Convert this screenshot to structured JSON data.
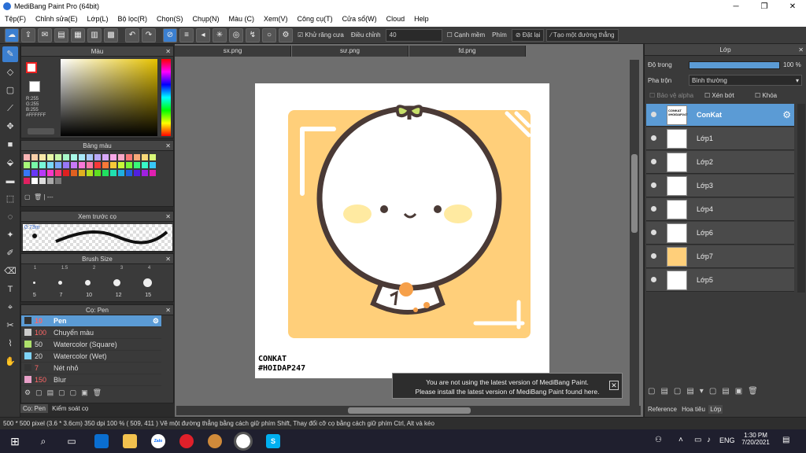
{
  "app": {
    "title": "MediBang Paint Pro (64bit)"
  },
  "menu": [
    "Tệp(F)",
    "Chỉnh sửa(E)",
    "Lớp(L)",
    "Bộ lọc(R)",
    "Chọn(S)",
    "Chụp(N)",
    "Màu (C)",
    "Xem(V)",
    "Công cụ(T)",
    "Cửa sổ(W)",
    "Cloud",
    "Help"
  ],
  "toolbar": {
    "antialias": "Khử răng cưa",
    "adjust": "Điều chỉnh",
    "adjust_value": "40",
    "edge": "Cạnh mềm",
    "key": "Phím",
    "reset": "Đặt lại",
    "straight": "Tạo một đường thẳng"
  },
  "color_panel": {
    "title": "Màu",
    "r": "R:255",
    "g": "G:255",
    "b": "B:255",
    "hex": "#FFFFFF"
  },
  "palette_panel": {
    "title": "Bảng màu",
    "name": "---"
  },
  "preview_panel": {
    "title": "Xem trước cọ",
    "size": "0.73m"
  },
  "brushsize_panel": {
    "title": "Brush Size",
    "sizes": [
      "5",
      "7",
      "10",
      "12",
      "15"
    ],
    "top_sizes": [
      "1",
      "1.5",
      "2",
      "3",
      "4"
    ]
  },
  "brush_panel": {
    "title": "Cọ: Pen",
    "items": [
      {
        "num": "10",
        "name": "Pen",
        "color": "#333333"
      },
      {
        "num": "100",
        "name": "Chuyển màu",
        "color": "#cccccc"
      },
      {
        "num": "50",
        "name": "Watercolor (Square)",
        "color": "#aee06b"
      },
      {
        "num": "20",
        "name": "Watercolor (Wet)",
        "color": "#7fd3f7"
      },
      {
        "num": "7",
        "name": "Nét nhỏ",
        "color": "#333333"
      },
      {
        "num": "150",
        "name": "Blur",
        "color": "#e8a0c8"
      }
    ]
  },
  "bottom_tabs": {
    "left1": "Cọ: Pen",
    "left2": "Kiểm soát cọ",
    "right1": "Reference",
    "right2": "Hoa tiêu",
    "right3": "Lớp"
  },
  "tabs": [
    "sx.png",
    "sư.png",
    "fd.png"
  ],
  "layer_panel": {
    "title": "Lớp",
    "opacity_label": "Độ trong",
    "opacity_value": "100 %",
    "blend_label": "Pha trộn",
    "blend_value": "Bình thường",
    "protect_alpha": "Bảo vệ alpha",
    "clipping": "Xén bớt",
    "lock": "Khóa",
    "layers": [
      {
        "name": "ConKat",
        "selected": true
      },
      {
        "name": "Lớp1",
        "selected": false
      },
      {
        "name": "Lớp2",
        "selected": false
      },
      {
        "name": "Lớp3",
        "selected": false
      },
      {
        "name": "Lớp4",
        "selected": false
      },
      {
        "name": "Lớp6",
        "selected": false
      },
      {
        "name": "Lớp7",
        "selected": false
      },
      {
        "name": "Lớp5",
        "selected": false
      }
    ]
  },
  "artwork": {
    "line1": "CONKAT",
    "line2": "#HOIDAP247",
    "thumb_text": "CONKAT #HOIDAP247"
  },
  "toast": {
    "line1": "You are not using the latest version of MediBang Paint.",
    "line2": "Please install the latest version of MediBang Paint found here."
  },
  "status": {
    "text": "500 * 500 pixel   (3.6 * 3.6cm)   350 dpi   100 %   ( 509, 411 )   Vẽ một đường thẳng bằng cách giữ phím Shift, Thay đổi cỡ cọ bằng cách giữ phím Ctrl, Alt và kéo"
  },
  "taskbar": {
    "time": "1:30 PM",
    "date": "7/20/2021",
    "lang": "ENG",
    "zalo": "Zalo"
  },
  "colors": {
    "accent": "#5b9bd5",
    "orange_bg": "#ffcf7a"
  }
}
